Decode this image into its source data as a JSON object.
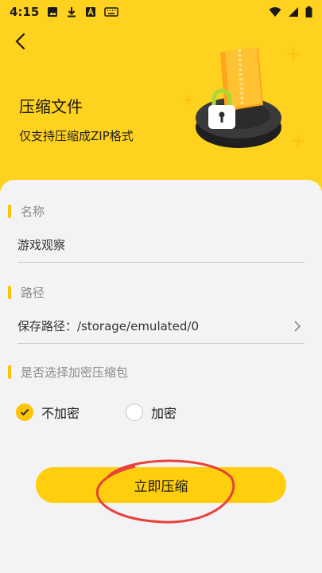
{
  "status_bar": {
    "time": "4:15",
    "left_icons": [
      "image-icon",
      "download-icon",
      "a-box-icon",
      "keyboard-icon"
    ],
    "right_icons": [
      "wifi-icon",
      "signal-icon",
      "battery-icon"
    ]
  },
  "header": {
    "title": "压缩文件",
    "subtitle": "仅支持压缩成ZIP格式"
  },
  "sections": {
    "name": {
      "label": "名称",
      "value": "游戏观察"
    },
    "path": {
      "label": "路径",
      "value": "保存路径：/storage/emulated/0"
    },
    "encrypt": {
      "label": "是否选择加密压缩包",
      "options": [
        {
          "label": "不加密",
          "checked": true
        },
        {
          "label": "加密",
          "checked": false
        }
      ]
    }
  },
  "action": {
    "compress_label": "立即压缩"
  },
  "colors": {
    "accent": "#ffd21f",
    "button": "#ffcf0d",
    "annotation": "#e8413a"
  }
}
